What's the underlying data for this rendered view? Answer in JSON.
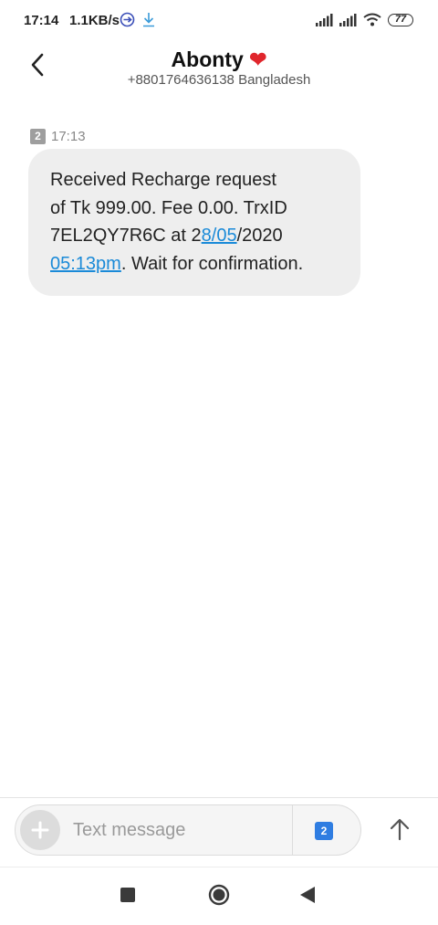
{
  "status_bar": {
    "time": "17:14",
    "speed": "1.1KB/s",
    "battery": "77",
    "icons": [
      "sync-icon",
      "download-icon",
      "signal-icon",
      "signal-icon",
      "wifi-icon",
      "battery-icon"
    ]
  },
  "header": {
    "contact_name": "Abonty",
    "heart": "❤",
    "phone": "+8801764636138",
    "country": "Bangladesh"
  },
  "thread": {
    "messages": [
      {
        "sim": "2",
        "time": "17:13",
        "lines": {
          "l1": "Received Recharge request",
          "l2": "of Tk 999.00. Fee 0.00. TrxID",
          "l3_pre": "7EL2QY7R6C at 2",
          "l3_link": "8/05",
          "l3_post": "/2020",
          "l4_link": "05:13pm",
          "l4_post": ". Wait for confirmation."
        }
      }
    ]
  },
  "composer": {
    "placeholder": "Text message",
    "value": "",
    "sim": "2"
  },
  "colors": {
    "link": "#1a8ad8",
    "bubble": "#eeeeee",
    "sim_select": "#2f7de1",
    "heart": "#e0262c"
  }
}
